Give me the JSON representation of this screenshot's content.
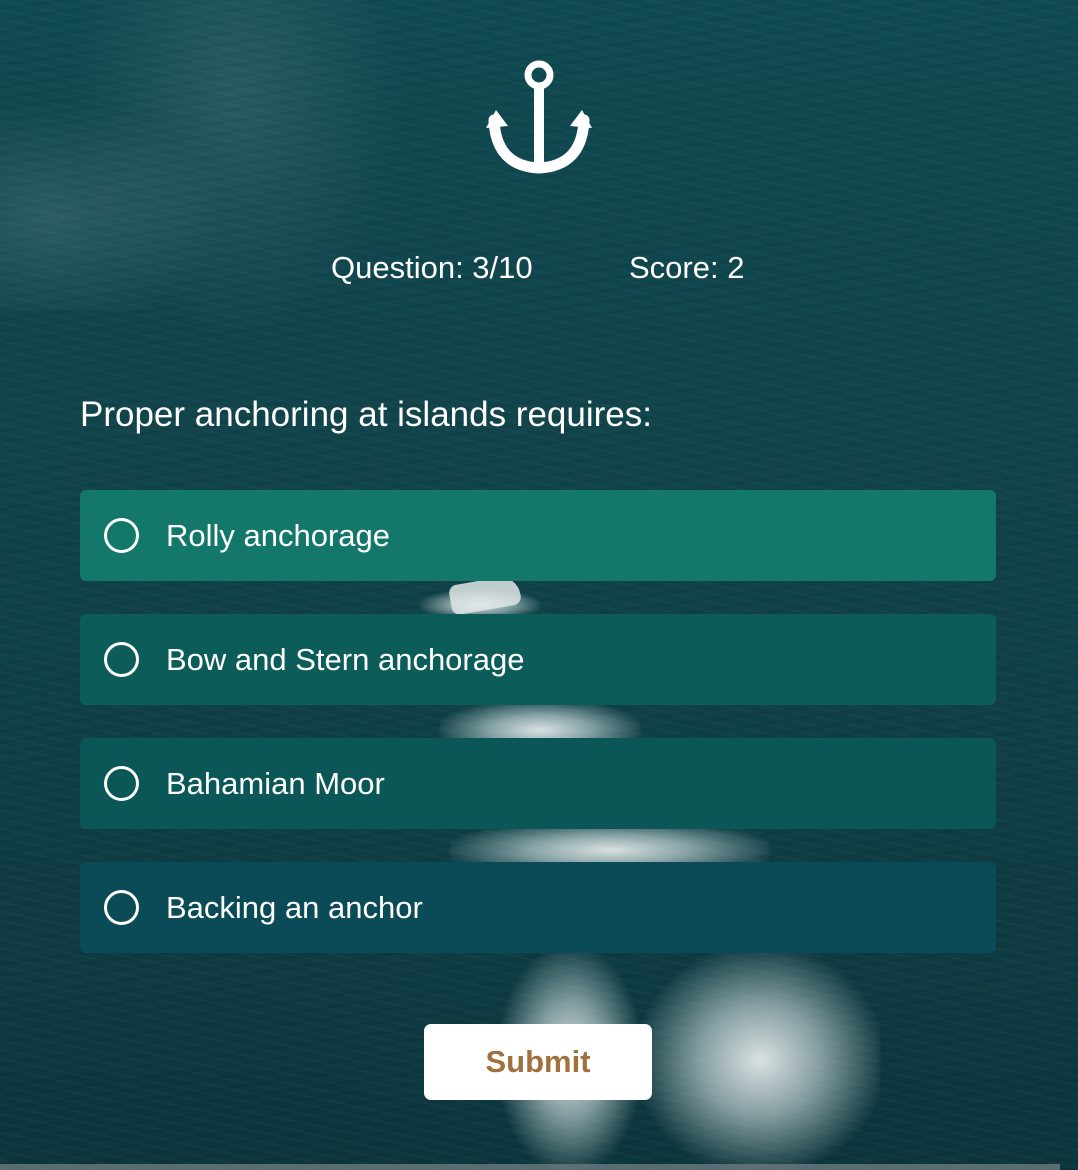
{
  "logo": {
    "icon": "anchor-icon"
  },
  "stats": {
    "question": "Question: 3/10",
    "score": "Score: 2"
  },
  "question": {
    "text": "Proper anchoring at islands requires:"
  },
  "options": [
    {
      "label": "Rolly anchorage",
      "color": "#13776a"
    },
    {
      "label": "Bow and Stern anchorage",
      "color": "#0c5d5a"
    },
    {
      "label": "Bahamian Moor",
      "color": "#0b5657"
    },
    {
      "label": "Backing an anchor",
      "color": "#0b4b58"
    }
  ],
  "submit": {
    "label": "Submit",
    "text_color": "#a0713c"
  }
}
